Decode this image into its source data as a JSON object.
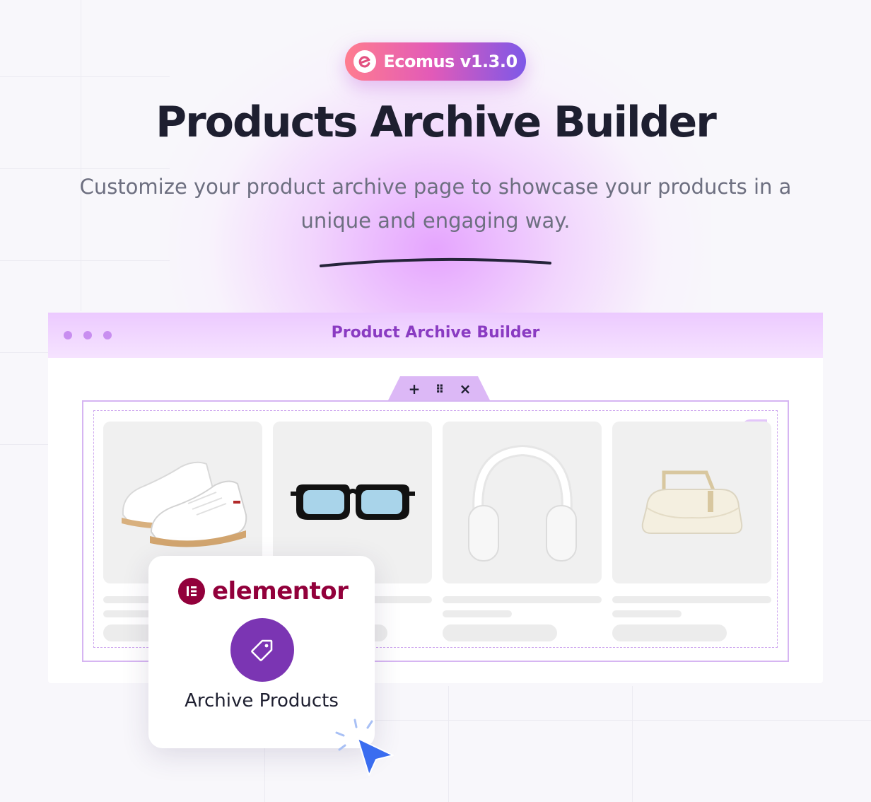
{
  "badge": {
    "label": "Ecomus v1.3.0"
  },
  "hero": {
    "title": "Products Archive Builder",
    "subtitle": "Customize your product archive page to showcase your products in a unique and engaging way."
  },
  "window": {
    "title": "Product Archive Builder",
    "toolbar": {
      "add": "+",
      "drag": "⠿",
      "close": "×"
    }
  },
  "products": [
    {
      "icon": "sneakers-image"
    },
    {
      "icon": "sunglasses-image"
    },
    {
      "icon": "headphones-image"
    },
    {
      "icon": "handbag-image"
    }
  ],
  "widget_panel": {
    "brand": "elementor",
    "widget_label": "Archive Products",
    "widget_icon": "tag-icon"
  },
  "colors": {
    "badge_gradient": [
      "#ff7d8f",
      "#e25ab8",
      "#7d58e8"
    ],
    "heading": "#1e1f30",
    "accent_purple": "#8a3bc2",
    "elementor": "#92003b",
    "widget_circle": "#7b35b3",
    "cursor": "#3a6df0"
  }
}
